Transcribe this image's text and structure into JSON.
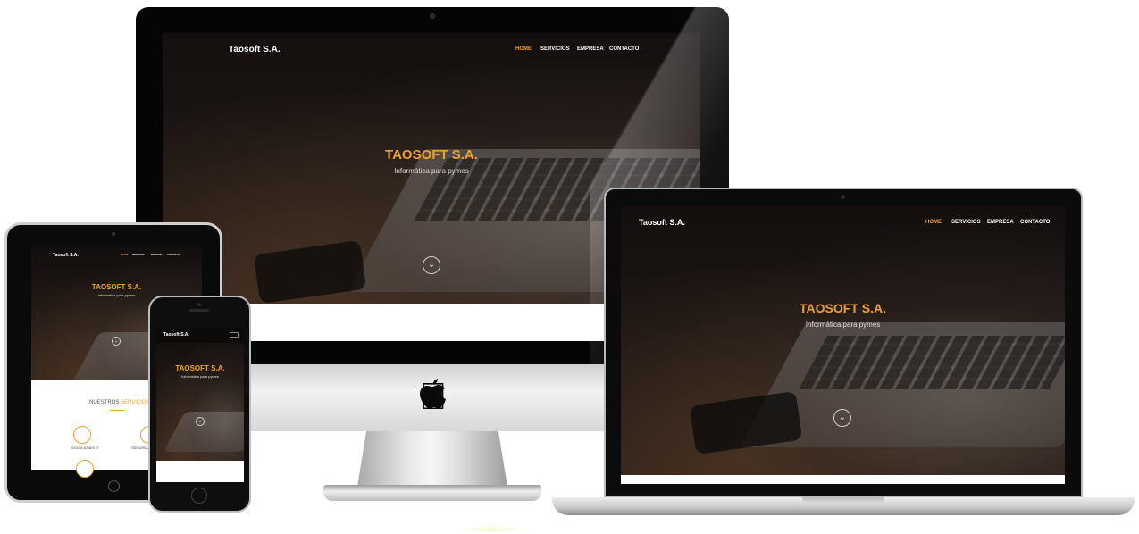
{
  "site": {
    "brand": "Taosoft S.A.",
    "brand_small": "Taosoft S.A.",
    "hero_title": "TAOSOFT S.A.",
    "hero_subtitle": "Informática para pymes",
    "scroll_icon": "chevron-down-icon",
    "accent_color": "#f0a030"
  },
  "nav": {
    "home": "HOME",
    "servicios": "SERVICIOS",
    "empresa": "EMPRESA",
    "contacto": "CONTACTO"
  },
  "services_section": {
    "heading_prefix": "NUESTROS ",
    "heading_highlight": "SERVICIOS",
    "items": [
      {
        "label": "SOLUCIONES IT",
        "icon": "monitor-icon"
      },
      {
        "label": "SEGURIDAD",
        "icon": "shield-icon"
      }
    ]
  },
  "devices": {
    "desktop_logo": "apple-logo-icon"
  }
}
